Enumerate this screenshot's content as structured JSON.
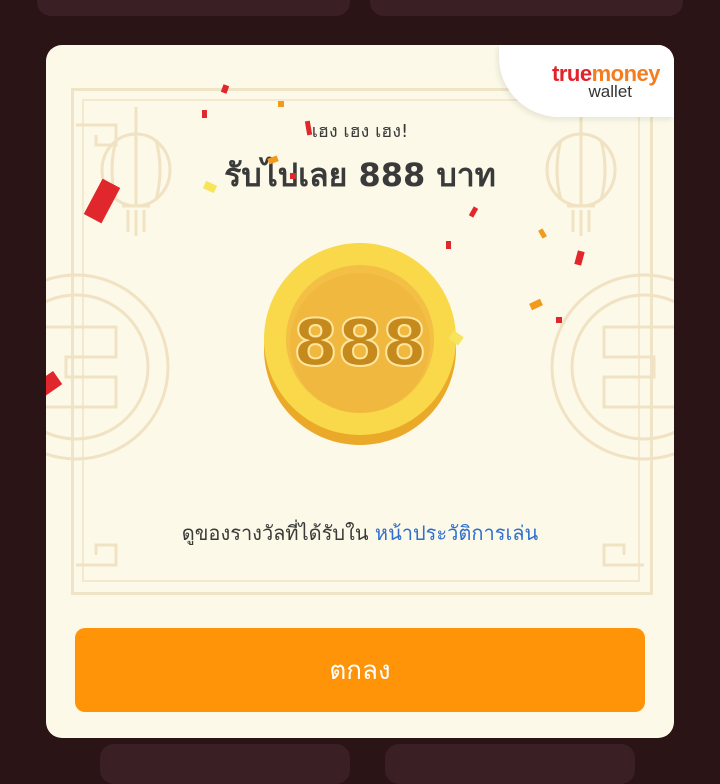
{
  "brand": {
    "true_text": "true",
    "money_text": "money",
    "wallet_text": "wallet"
  },
  "reward": {
    "subtitle": "เฮง เฮง เฮง!",
    "title": "รับไปเลย 888 บาท",
    "coin_value": "888"
  },
  "info": {
    "text": "ดูของรางวัลที่ได้รับใน ",
    "link_text": "หน้าประวัติการเล่น"
  },
  "actions": {
    "ok_label": "ตกลง"
  },
  "colors": {
    "background": "#2a1416",
    "modal": "#fcf9e8",
    "button": "#ff9409",
    "link": "#2f6fd0",
    "coin": "#f6c53a"
  }
}
